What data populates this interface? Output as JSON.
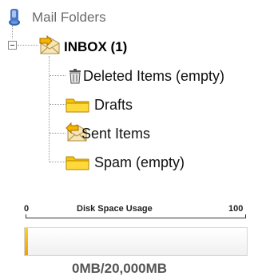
{
  "tree": {
    "root_label": "Mail Folders",
    "inbox_label": "INBOX (1)",
    "items": [
      {
        "label": "Deleted Items  (empty)",
        "icon": "trash-icon"
      },
      {
        "label": "Drafts",
        "icon": "folder-icon"
      },
      {
        "label": "Sent Items",
        "icon": "sent-envelope-icon"
      },
      {
        "label": "Spam  (empty)",
        "icon": "folder-icon"
      }
    ]
  },
  "disk_usage": {
    "title": "Disk Space Usage",
    "scale_min": "0",
    "scale_max": "100",
    "used_percent": 1,
    "usage_text": "0MB/20,000MB"
  },
  "colors": {
    "folder_yellow": "#f6c400",
    "bar_fill": "#f5b400",
    "root_icon_blue": "#4a78c8"
  }
}
